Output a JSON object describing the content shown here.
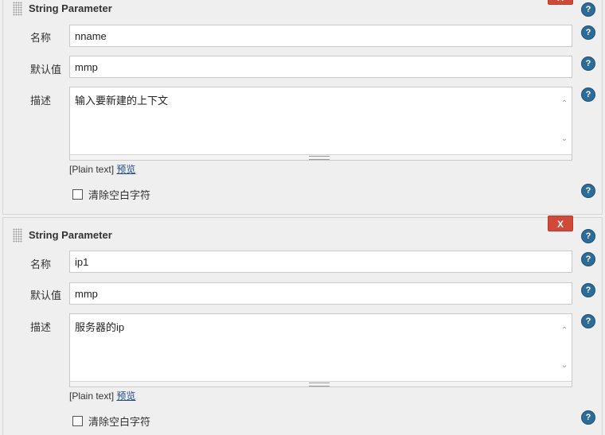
{
  "blocks": [
    {
      "title": "String Parameter",
      "delete_label": "X",
      "name_label": "名称",
      "name_value": "nname",
      "default_label": "默认值",
      "default_value": "mmp",
      "description_label": "描述",
      "description_value": "输入要新建的上下文",
      "plain_text": "[Plain text]",
      "preview_link": "预览",
      "trim_label": "清除空白字符"
    },
    {
      "title": "String Parameter",
      "delete_label": "X",
      "name_label": "名称",
      "name_value": "ip1",
      "default_label": "默认值",
      "default_value": "mmp",
      "description_label": "描述",
      "description_value": "服务器的ip",
      "plain_text": "[Plain text]",
      "preview_link": "预览",
      "trim_label": "清除空白字符"
    }
  ],
  "icons": {
    "help": "question-mark-help-icon",
    "drag": "drag-grip-icon",
    "scroll_up": "chevron-up-icon",
    "scroll_down": "chevron-down-icon"
  },
  "colors": {
    "delete_button": "#d24939",
    "help_icon": "#2d6b98",
    "link": "#204a87"
  }
}
